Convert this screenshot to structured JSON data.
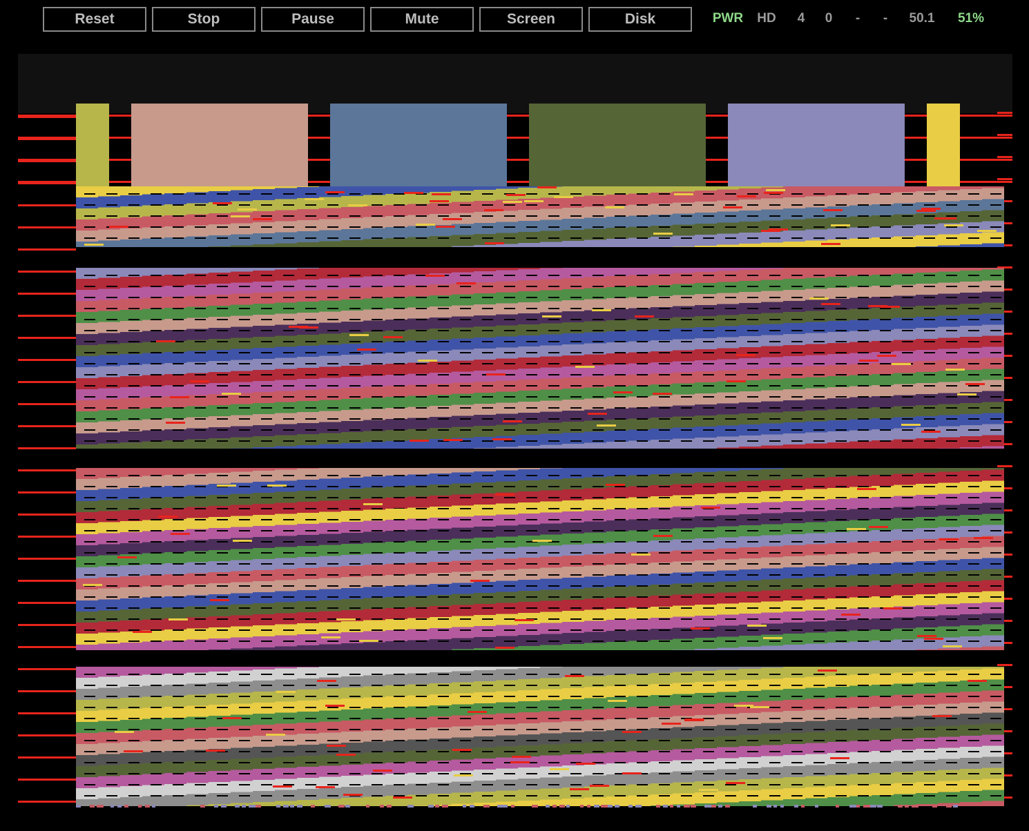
{
  "toolbar": {
    "buttons": [
      "Reset",
      "Stop",
      "Pause",
      "Mute",
      "Screen",
      "Disk"
    ]
  },
  "status": {
    "power": "PWR",
    "drive": "HD",
    "track": "4",
    "sector": "0",
    "field_a": "-",
    "field_b": "-",
    "refresh": "50.1",
    "speed": "51%"
  },
  "colors": {
    "background": "#000000",
    "border_band": "#111111",
    "button_border": "#8a8a8a",
    "button_text": "#bdbdbd",
    "status_green": "#8fd98a",
    "status_gray": "#9a9a9a",
    "raster_red": "#e8241c",
    "palette": [
      "#b7b64b",
      "#c79a8c",
      "#5b7699",
      "#566536",
      "#8a89b9",
      "#e9cd44",
      "#3f54a8",
      "#b32a39",
      "#b55a9e",
      "#c85a64",
      "#4f8f47",
      "#4b2f5a",
      "#8e8e8e",
      "#d1d1d1",
      "#555555"
    ]
  },
  "sprite_bars": [
    {
      "color": "#b7b64b"
    },
    {
      "color": "#c79a8c"
    },
    {
      "color": "#5b7699"
    },
    {
      "color": "#566536"
    },
    {
      "color": "#8a89b9"
    },
    {
      "color": "#e9cd44"
    }
  ],
  "band_groups": [
    {
      "palette": [
        "#c79a8c",
        "#5b7699",
        "#566536",
        "#8a89b9",
        "#e9cd44",
        "#3f54a8",
        "#b7b64b",
        "#c85a64"
      ]
    },
    {
      "palette": [
        "#8a89b9",
        "#b32a39",
        "#b55a9e",
        "#c85a64",
        "#4f8f47",
        "#c79a8c",
        "#4b2f5a",
        "#566536",
        "#3f54a8"
      ]
    },
    {
      "palette": [
        "#b32a39",
        "#e9cd44",
        "#b55a9e",
        "#4b2f5a",
        "#4f8f47",
        "#8a89b9",
        "#c85a64",
        "#c79a8c",
        "#3f54a8",
        "#566536"
      ]
    },
    {
      "palette": [
        "#c85a64",
        "#c79a8c",
        "#555555",
        "#566536",
        "#b55a9e",
        "#d1d1d1",
        "#8e8e8e",
        "#b7b64b",
        "#e9cd44",
        "#4f8f47"
      ]
    }
  ]
}
